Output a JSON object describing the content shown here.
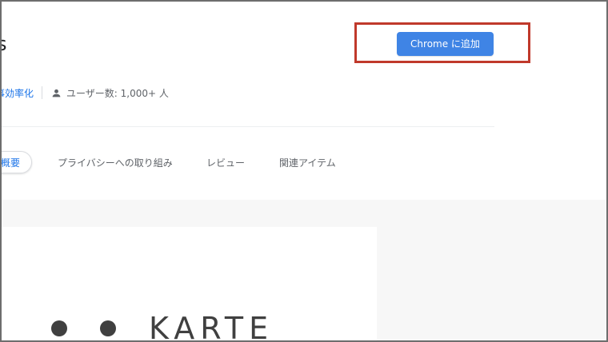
{
  "extension": {
    "title_fragment": "s",
    "add_button_label": "Chrome に追加",
    "category": "事効率化",
    "user_count": "ユーザー数: 1,000+ 人"
  },
  "tabs": [
    {
      "label": "概要"
    },
    {
      "label": "プライバシーへの取り組み"
    },
    {
      "label": "レビュー"
    },
    {
      "label": "関連アイテム"
    }
  ],
  "gallery": {
    "logo_text": "KARTE"
  },
  "colors": {
    "accent_blue": "#3f84e5",
    "highlight_red": "#c0392b",
    "link_blue": "#1a73e8"
  },
  "icons": {
    "user": "person-icon"
  }
}
